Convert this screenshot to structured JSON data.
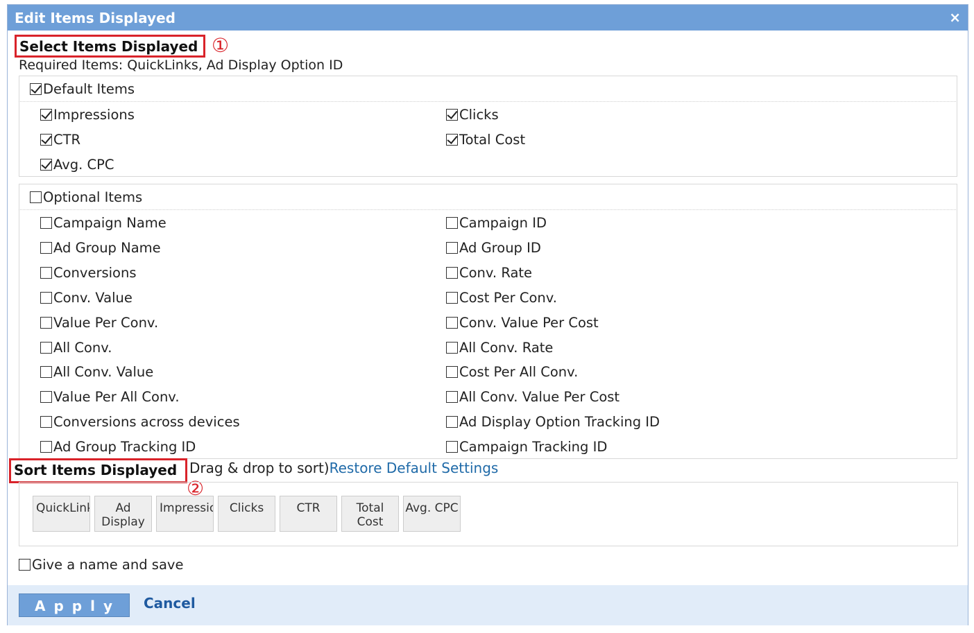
{
  "dialog": {
    "title": "Edit Items Displayed",
    "close_glyph": "×"
  },
  "select_section": {
    "heading": "Select Items Displayed",
    "marker": "①",
    "required_text": "Required Items: QuickLinks, Ad Display Option ID"
  },
  "default_items": {
    "label": "Default Items",
    "checked": true,
    "items": [
      {
        "label": "Impressions",
        "checked": true
      },
      {
        "label": "Clicks",
        "checked": true
      },
      {
        "label": "CTR",
        "checked": true
      },
      {
        "label": "Total Cost",
        "checked": true
      },
      {
        "label": "Avg. CPC",
        "checked": true
      }
    ]
  },
  "optional_items": {
    "label": "Optional Items",
    "checked": false,
    "items": [
      {
        "label": "Campaign Name",
        "checked": false
      },
      {
        "label": "Campaign ID",
        "checked": false
      },
      {
        "label": "Ad Group Name",
        "checked": false
      },
      {
        "label": "Ad Group ID",
        "checked": false
      },
      {
        "label": "Conversions",
        "checked": false
      },
      {
        "label": "Conv. Rate",
        "checked": false
      },
      {
        "label": "Conv. Value",
        "checked": false
      },
      {
        "label": "Cost Per Conv.",
        "checked": false
      },
      {
        "label": "Value Per Conv.",
        "checked": false
      },
      {
        "label": "Conv. Value Per Cost",
        "checked": false
      },
      {
        "label": "All Conv.",
        "checked": false
      },
      {
        "label": "All Conv. Rate",
        "checked": false
      },
      {
        "label": "All Conv. Value",
        "checked": false
      },
      {
        "label": "Cost Per All Conv.",
        "checked": false
      },
      {
        "label": "Value Per All Conv.",
        "checked": false
      },
      {
        "label": "All Conv. Value Per Cost",
        "checked": false
      },
      {
        "label": "Conversions across devices",
        "checked": false
      },
      {
        "label": "Ad Display Option Tracking ID",
        "checked": false
      },
      {
        "label": "Ad Group Tracking ID",
        "checked": false
      },
      {
        "label": "Campaign Tracking ID",
        "checked": false
      }
    ]
  },
  "sort_section": {
    "heading": "Sort Items Displayed",
    "marker": "②",
    "hint": "Drag & drop to sort)",
    "restore_link": "Restore Default Settings",
    "chips": [
      "QuickLinks",
      "Ad Display",
      "Impressions",
      "Clicks",
      "CTR",
      "Total Cost",
      "Avg. CPC"
    ]
  },
  "save_option": {
    "label": "Give a name and save",
    "checked": false
  },
  "footer": {
    "apply_label": "Apply",
    "cancel_label": "Cancel"
  },
  "colors": {
    "titlebar": "#6e9fd8",
    "highlight_red": "#d9232a",
    "link_blue": "#1f6aa8",
    "footer_bg": "#e1ecf9"
  }
}
